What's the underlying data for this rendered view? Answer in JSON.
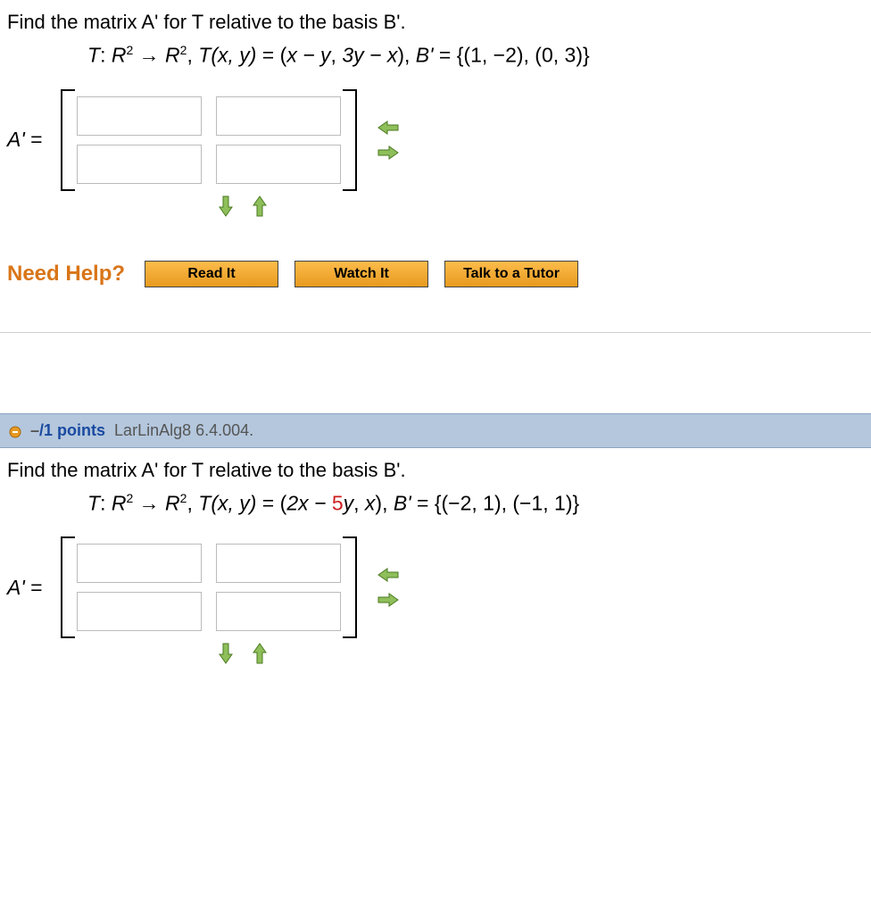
{
  "q1": {
    "prompt_parts": {
      "before": "Find the matrix ",
      "Aprime": "A'",
      "mid1": " for ",
      "T": "T",
      "mid2": " relative to the basis ",
      "Bprime": "B'",
      "after": "."
    },
    "math": {
      "T": "T",
      "colon": ": ",
      "R": "R",
      "sup2": "2",
      "arrow": " → ",
      "comma1": ", ",
      "Tcall": "T",
      "paren_xy": "(x, y)",
      "eq": " = ",
      "rhs_open": "(",
      "rhs_inner_a": "x − y",
      "rhs_sep": ", ",
      "rhs_inner_b": "3y − x",
      "rhs_close": ")",
      "comma2": ", ",
      "Bprime": "B'",
      "eqB": " = ",
      "Bset": "{(1, −2), (0, 3)}"
    },
    "answer_label_parts": {
      "A": "A",
      "prime": "'",
      "eq": " = "
    },
    "need_help_label": "Need Help?",
    "buttons": {
      "read": "Read It",
      "watch": "Watch It",
      "tutor": "Talk to a Tutor"
    }
  },
  "q2_header": {
    "score_dash": "–",
    "points": "/1 points",
    "ref": "LarLinAlg8 6.4.004."
  },
  "q2": {
    "prompt_parts": {
      "before": "Find the matrix ",
      "Aprime": "A'",
      "mid1": " for ",
      "T": "T",
      "mid2": " relative to the basis ",
      "Bprime": "B'",
      "after": "."
    },
    "math": {
      "T": "T",
      "colon": ": ",
      "R": "R",
      "sup2": "2",
      "arrow": " → ",
      "comma1": ", ",
      "Tcall": "T",
      "paren_xy": "(x, y)",
      "eq": " = ",
      "rhs_open": "(",
      "rhs_inner_a_pre": "2x − ",
      "rhs_inner_a_red": "5",
      "rhs_inner_a_post": "y",
      "rhs_sep": ", ",
      "rhs_inner_b": "x",
      "rhs_close": ")",
      "comma2": ", ",
      "Bprime": "B'",
      "eqB": " = ",
      "Bset": "{(−2, 1), (−1, 1)}"
    },
    "answer_label_parts": {
      "A": "A",
      "prime": "'",
      "eq": " = "
    }
  }
}
